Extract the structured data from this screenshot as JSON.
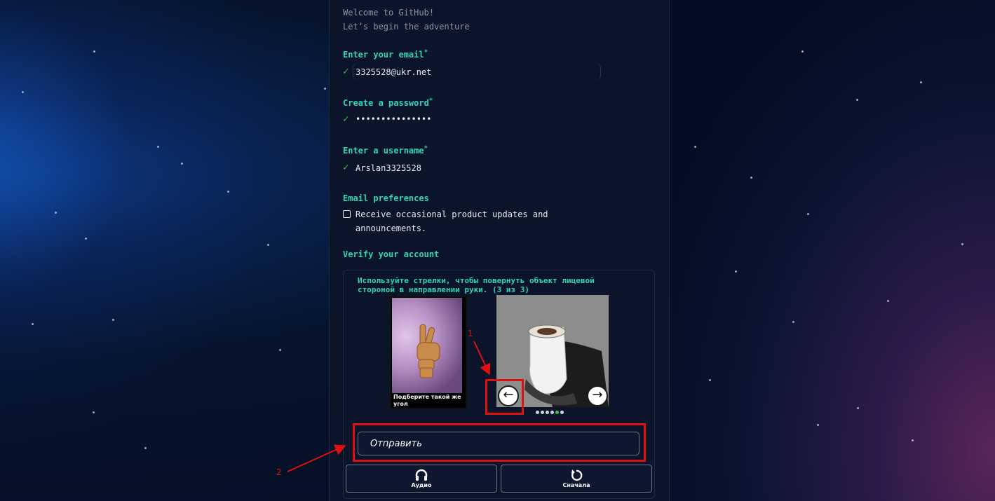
{
  "intro": {
    "line1": "Welcome to GitHub!",
    "line2": "Let’s begin the adventure"
  },
  "fields": {
    "email": {
      "label": "Enter your email",
      "required_mark": "*",
      "value": "3325528@ukr.net"
    },
    "password": {
      "label": "Create a password",
      "required_mark": "*",
      "value": "•••••••••••••••"
    },
    "username": {
      "label": "Enter a username",
      "required_mark": "*",
      "value": "Arslan3325528"
    }
  },
  "valid_mark": "✓",
  "email_preferences": {
    "label": "Email preferences",
    "checkbox_text_line1": "Receive occasional product updates and",
    "checkbox_text_line2": "announcements.",
    "checked": false
  },
  "verify": {
    "label": "Verify your account",
    "instruction": "Используйте стрелки, чтобы повернуть объект лицевой стороной в направлении руки. (3 из 3)",
    "reference_caption": "Подберите такой же угол",
    "left_arrow": "←",
    "right_arrow": "→",
    "dots_total": 6,
    "dots_active_index": 4,
    "submit_label": "Отправить",
    "audio_label": "Аудио",
    "restart_label": "Сначала"
  },
  "annotations": {
    "marker1": "1",
    "marker2": "2",
    "color": "#e01010"
  },
  "colors": {
    "accent": "#2dd4bf",
    "valid": "#3fb950",
    "panel_bg": "#0b1428"
  }
}
